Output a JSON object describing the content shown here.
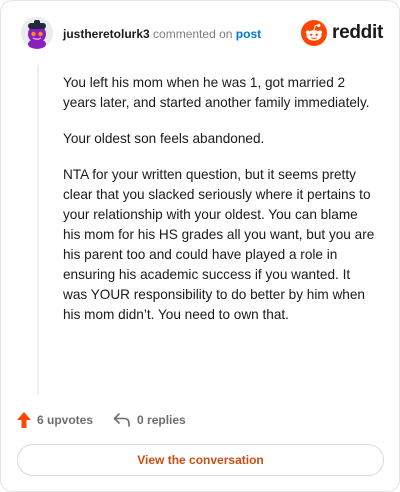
{
  "header": {
    "username": "justheretolurk3",
    "verb": "commented on",
    "post_link": "post",
    "brand": "reddit"
  },
  "comment": {
    "paragraphs": [
      "You left his mom when he was 1, got married 2 years later, and started another family immediately.",
      "Your oldest son feels abandoned.",
      "NTA for your written question, but it seems pretty clear that you slacked seriously where it pertains to your relationship with your oldest. You can blame his mom for his HS grades all you want, but you are his parent too and could have played a role in ensuring his academic success if you wanted. It was YOUR responsibility to do better by him when his mom didn’t. You need to own that."
    ]
  },
  "actions": {
    "upvotes": "6 upvotes",
    "replies": "0 replies"
  },
  "cta": {
    "label": "View the conversation"
  },
  "colors": {
    "upvote": "#ff4500",
    "link": "#0079d3",
    "cta_text": "#c84e14",
    "brand": "#ff4500"
  },
  "icons": {
    "avatar": "snoo-avatar",
    "brand": "reddit-logo-icon",
    "upvote": "upvote-arrow-icon",
    "reply": "reply-arrow-icon"
  }
}
